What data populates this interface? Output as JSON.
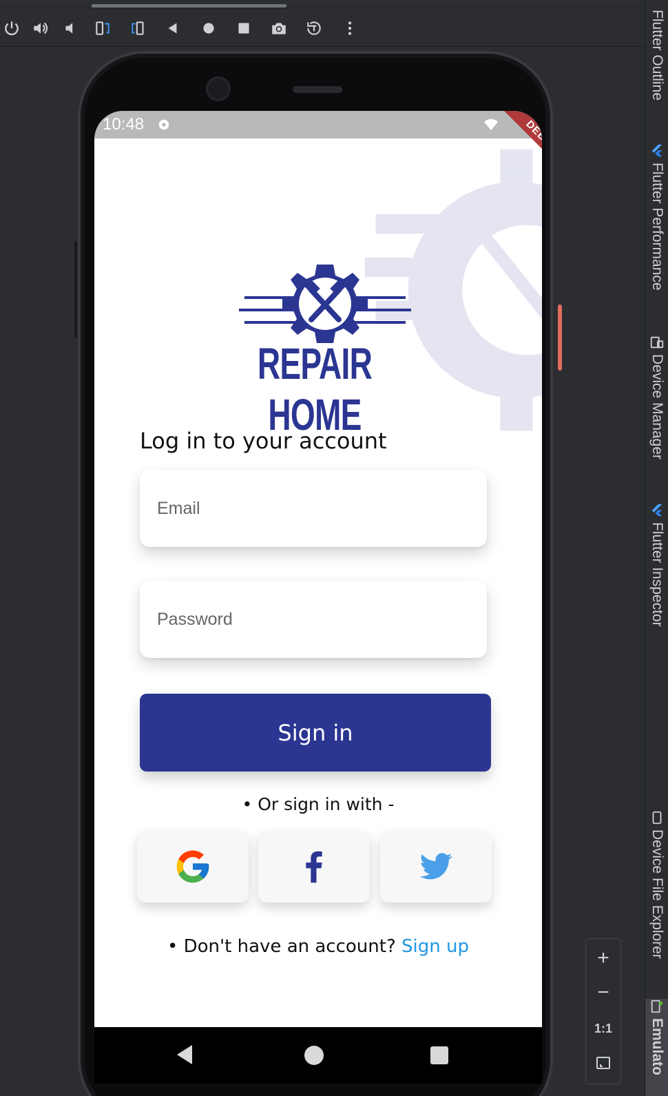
{
  "ide": {
    "toolbar_buttons": [
      "power-icon",
      "volume-up-icon",
      "volume-down-icon",
      "rotate-left-icon",
      "rotate-right-icon",
      "back-icon",
      "home-icon",
      "overview-icon",
      "camera-icon",
      "snapshot-icon",
      "more-icon"
    ],
    "right_tabs": [
      {
        "label": "Flutter Outline"
      },
      {
        "label": "Flutter Performance"
      },
      {
        "label": "Device Manager"
      },
      {
        "label": "Flutter Inspector"
      },
      {
        "label": "Device File Explorer"
      },
      {
        "label": "Emulato"
      }
    ],
    "zoom": {
      "plus": "+",
      "minus": "−",
      "one_to_one": "1:1"
    }
  },
  "device": {
    "time": "10:48",
    "debug_banner": "DEBUG"
  },
  "app": {
    "brand": "REPAIR HOME",
    "heading": "Log in to your account",
    "email_placeholder": "Email",
    "password_placeholder": "Password",
    "signin_label": "Sign in",
    "or_text": "• Or sign in with -",
    "social": [
      {
        "name": "google",
        "icon": "google-icon"
      },
      {
        "name": "facebook",
        "icon": "facebook-icon"
      },
      {
        "name": "twitter",
        "icon": "twitter-icon"
      }
    ],
    "signup_prompt": "• Don't have an account? ",
    "signup_link": "Sign up",
    "colors": {
      "primary": "#2b3592",
      "link": "#2196e3",
      "facebook": "#2b3592",
      "twitter": "#4a9fe8"
    }
  }
}
